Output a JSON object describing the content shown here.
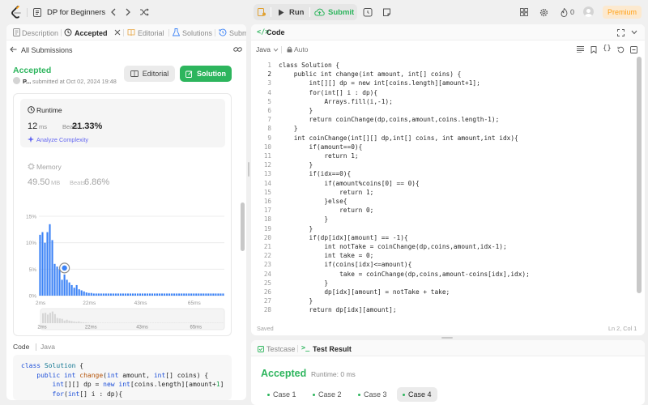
{
  "topbar": {
    "list_title": "DP for Beginners",
    "run_label": "Run",
    "submit_label": "Submit",
    "streak_count": "0",
    "premium_label": "Premium"
  },
  "left_tabs": [
    {
      "label": "Description"
    },
    {
      "label": "Accepted"
    },
    {
      "label": "Editorial"
    },
    {
      "label": "Solutions"
    },
    {
      "label": "Submi"
    }
  ],
  "submission": {
    "back_label": "All Submissions",
    "status": "Accepted",
    "user": "P...",
    "submitted_at": "submitted at Oct 02, 2024 19:48",
    "editorial_button": "Editorial",
    "solution_button": "Solution",
    "runtime_title": "Runtime",
    "runtime_value": "12",
    "runtime_unit": "ms",
    "beats_label": "Beats",
    "runtime_beats": "21.33%",
    "analyze_label": "Analyze Complexity",
    "memory_title": "Memory",
    "memory_value": "49.50",
    "memory_unit": "MB",
    "memory_beats": "6.86%",
    "code_label": "Code",
    "code_lang": "Java"
  },
  "chart_data": {
    "type": "bar",
    "y_ticks": [
      "15%",
      "10%",
      "5%",
      "0%"
    ],
    "x_ticks": [
      "2ms",
      "22ms",
      "43ms",
      "65ms"
    ],
    "overview_ticks": [
      "2ms",
      "22ms",
      "43ms",
      "65ms"
    ],
    "ylim": [
      0,
      15
    ],
    "values": [
      11.5,
      12,
      10,
      12,
      13.5,
      10.5,
      6,
      5.5,
      5,
      3,
      4,
      3,
      2.5,
      2,
      1.5,
      2,
      1.2,
      1,
      0.8,
      0.6,
      0.5,
      0.5,
      0.4,
      0.4,
      0.4,
      0.4,
      0.4,
      0.4,
      0.4,
      0.4,
      0.4,
      0.4,
      0.4,
      0.4,
      0.4,
      0.4,
      0.4,
      0.4,
      0.4,
      0.4,
      0.4,
      0.4,
      0.4,
      0.4,
      0.4,
      0.4,
      0.4,
      0.4,
      0.4,
      0.4,
      0.4,
      0.4,
      0.4,
      0.4,
      0.4,
      0.4,
      0.4,
      0.4,
      0.4,
      0.4,
      0.4,
      0.4,
      0.4,
      0.4,
      0.4,
      0.4,
      0.4,
      0.4,
      0.4,
      0.4,
      0.4,
      0.4,
      0.4,
      0.4,
      0.4,
      0.4
    ],
    "highlight_index": 10
  },
  "preview_code": [
    "class Solution {",
    "    public int change(int amount, int[] coins) {",
    "        int[][] dp = new int[coins.length][amount+1]",
    "        for(int[] i : dp){"
  ],
  "editor": {
    "title": "Code",
    "language": "Java",
    "auto_label": "Auto",
    "saved_label": "Saved",
    "cursor_pos": "Ln 2, Col 1",
    "lines": [
      {
        "no": "1",
        "text": "class Solution {"
      },
      {
        "no": "2",
        "text": "    public int change(int amount, int[] coins) {"
      },
      {
        "no": "3",
        "text": "        int[][] dp = new int[coins.length][amount+1];"
      },
      {
        "no": "4",
        "text": "        for(int[] i : dp){"
      },
      {
        "no": "5",
        "text": "            Arrays.fill(i,-1);"
      },
      {
        "no": "6",
        "text": "        }"
      },
      {
        "no": "7",
        "text": "        return coinChange(dp,coins,amount,coins.length-1);"
      },
      {
        "no": "8",
        "text": "    }"
      },
      {
        "no": "9",
        "text": "    int coinChange(int[][] dp,int[] coins, int amount,int idx){"
      },
      {
        "no": "10",
        "text": "        if(amount==0){"
      },
      {
        "no": "11",
        "text": "            return 1;"
      },
      {
        "no": "12",
        "text": "        }"
      },
      {
        "no": "13",
        "text": "        if(idx==0){"
      },
      {
        "no": "14",
        "text": "            if(amount%coins[0] == 0){"
      },
      {
        "no": "15",
        "text": "                return 1;"
      },
      {
        "no": "16",
        "text": "            }else{"
      },
      {
        "no": "17",
        "text": "                return 0;"
      },
      {
        "no": "18",
        "text": "            }"
      },
      {
        "no": "19",
        "text": "        }"
      },
      {
        "no": "20",
        "text": "        if(dp[idx][amount] == -1){"
      },
      {
        "no": "21",
        "text": "            int notTake = coinChange(dp,coins,amount,idx-1);"
      },
      {
        "no": "22",
        "text": "            int take = 0;"
      },
      {
        "no": "23",
        "text": "            if(coins[idx]<=amount){"
      },
      {
        "no": "24",
        "text": "                take = coinChange(dp,coins,amount-coins[idx],idx);"
      },
      {
        "no": "25",
        "text": "            }"
      },
      {
        "no": "26",
        "text": "            dp[idx][amount] = notTake + take;"
      },
      {
        "no": "27",
        "text": "        }"
      },
      {
        "no": "28",
        "text": "        return dp[idx][amount];"
      }
    ]
  },
  "bottom": {
    "testcase_tab": "Testcase",
    "result_tab": "Test Result",
    "result_status": "Accepted",
    "runtime_text": "Runtime: 0 ms",
    "cases": [
      "Case 1",
      "Case 2",
      "Case 3",
      "Case 4"
    ]
  },
  "colors": {
    "accepted": "#2db55d",
    "accent_orange": "#ffa116",
    "bar_blue": "#3b82f6"
  }
}
